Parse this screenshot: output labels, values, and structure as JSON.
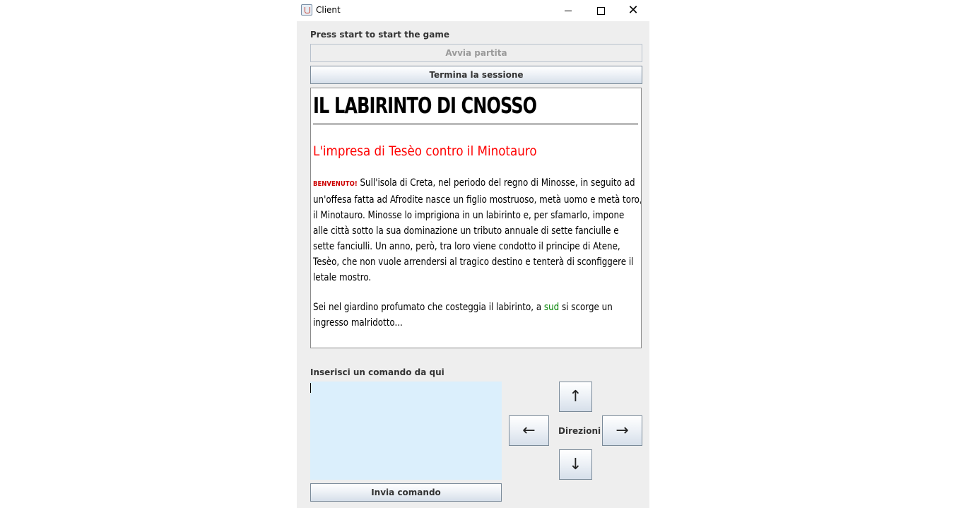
{
  "window": {
    "title": "Client"
  },
  "header": {
    "instruction": "Press start to start the game"
  },
  "buttons": {
    "start": "Avvia partita",
    "end_session": "Termina la sessione",
    "send": "Invia comando"
  },
  "story": {
    "title": "IL LABIRINTO DI CNOSSO",
    "subtitle": "L'impresa di Tesèo contro il Minotauro",
    "welcome": "BENVENUTO!",
    "paragraph1_lines": [
      "Sull'isola di Creta, nel periodo del regno di Minosse, in seguito ad",
      "un'offesa fatta ad Afrodite nasce un figlio mostruoso, metà uomo e metà toro,",
      "il Minotauro. Minosse lo imprigiona in un labirinto e, per sfamarlo, impone",
      "alle città sotto la sua dominazione un tributo annuale di sette fanciulle e",
      "sette fanciulli. Un anno, però, tra loro viene condotto il principe di Atene,",
      "Tesèo, che non vuole arrendersi al tragico destino e tenterà di sconfiggere il",
      "letale mostro."
    ],
    "paragraph2_before": "Sei nel giardino profumato che costeggia il labirinto, a",
    "paragraph2_highlight": "sud",
    "paragraph2_after": "si scorge un",
    "paragraph2_line2": "ingresso malridotto..."
  },
  "command": {
    "label": "Inserisci un comando da qui",
    "value": ""
  },
  "directions": {
    "label": "Direzioni",
    "north": "↑",
    "south": "↓",
    "west": "←",
    "east": "→"
  },
  "colors": {
    "title_red": "#ff0000",
    "highlight_green": "#008000",
    "input_bg": "#dbeffc"
  }
}
